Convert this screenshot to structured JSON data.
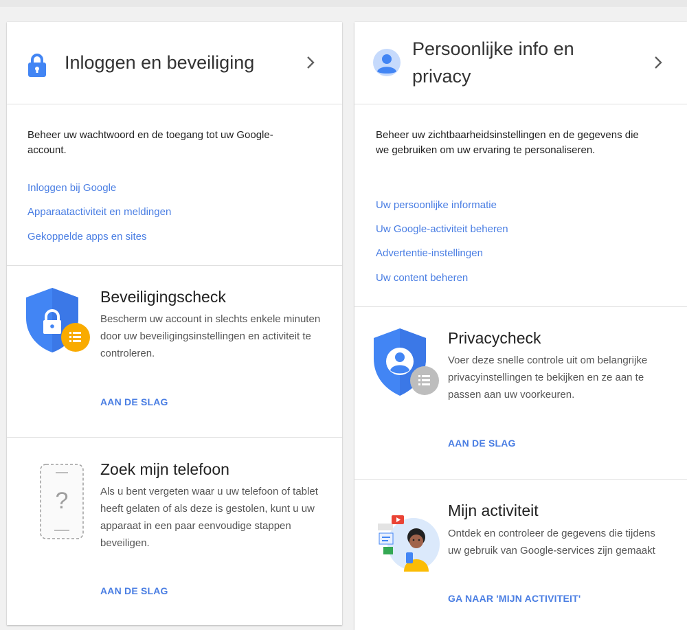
{
  "colors": {
    "accent": "#4285F4",
    "link": "#4a7ee3",
    "badge_yellow": "#F9AB00",
    "badge_grey": "#BDBDBD"
  },
  "left": {
    "title": "Inloggen en beveiliging",
    "description": "Beheer uw wachtwoord en de toegang tot uw Google-account.",
    "links": [
      "Inloggen bij Google",
      "Apparaatactiviteit en meldingen",
      "Gekoppelde apps en sites"
    ],
    "security_check": {
      "title": "Beveiligingscheck",
      "body": "Bescherm uw account in slechts enkele minuten door uw beveiligingsinstellingen en activiteit te controleren.",
      "action": "AAN DE SLAG"
    },
    "find_phone": {
      "title": "Zoek mijn telefoon",
      "body": "Als u bent vergeten waar u uw telefoon of tablet heeft gelaten of als deze is gestolen, kunt u uw apparaat in een paar eenvoudige stappen beveiligen.",
      "action": "AAN DE SLAG"
    }
  },
  "right": {
    "title": "Persoonlijke info en privacy",
    "description": "Beheer uw zichtbaarheidsinstellingen en de gegevens die we gebruiken om uw ervaring te personaliseren.",
    "links": [
      "Uw persoonlijke informatie",
      "Uw Google-activiteit beheren",
      "Advertentie-instellingen",
      "Uw content beheren"
    ],
    "privacy_check": {
      "title": "Privacycheck",
      "body": "Voer deze snelle controle uit om belangrijke privacyinstellingen te bekijken en ze aan te passen aan uw voorkeuren.",
      "action": "AAN DE SLAG"
    },
    "my_activity": {
      "title": "Mijn activiteit",
      "body": "Ontdek en controleer de gegevens die tijdens uw gebruik van Google-services zijn gemaakt",
      "action": "GA NAAR 'MIJN ACTIVITEIT'"
    }
  }
}
